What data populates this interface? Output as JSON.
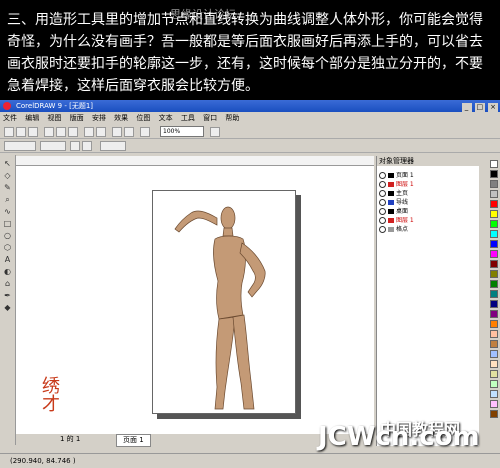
{
  "caption": {
    "watermark": "思缘设计论坛",
    "lines": [
      "三、用造形工具里的增加节点和直线转换为曲线调整人体外形，你可能会觉得",
      "奇怪，为什么没有画手？吾一般都是等后面衣服画好后再添上手的，可以省去",
      "画衣服时还要扣手的轮廓这一步，还有，这时候每个部分是独立分开的，不要",
      "急着焊接，这样后面穿衣服会比较方便。"
    ]
  },
  "app": {
    "title": "CorelDRAW 9 - [无题1]",
    "window_buttons": [
      "_",
      "□",
      "×"
    ],
    "menu": [
      "文件",
      "编辑",
      "视图",
      "版面",
      "安排",
      "效果",
      "位图",
      "文本",
      "工具",
      "窗口",
      "帮助"
    ],
    "zoom": "100%",
    "page_number": "1 的 1",
    "page_tab": "页面 1",
    "status_coords": "(290.940, 84.746 )"
  },
  "layers": {
    "title": "对象管理器",
    "rows": [
      {
        "name": "页面 1",
        "color": "#000000",
        "red": false
      },
      {
        "name": "图层 1",
        "color": "#d02020",
        "red": true
      },
      {
        "name": "主页",
        "color": "#000000",
        "red": false
      },
      {
        "name": "导线",
        "color": "#2040c0",
        "red": false
      },
      {
        "name": "桌面",
        "color": "#000000",
        "red": false
      },
      {
        "name": "图层 1",
        "color": "#d02020",
        "red": true
      },
      {
        "name": "格点",
        "color": "#999999",
        "red": false
      }
    ]
  },
  "figure": {
    "skin_color": "#c49a76"
  },
  "palette": [
    "#ffffff",
    "#000000",
    "#808080",
    "#c0c0c0",
    "#ff0000",
    "#ffff00",
    "#00ff00",
    "#00ffff",
    "#0000ff",
    "#ff00ff",
    "#800000",
    "#808000",
    "#008000",
    "#008080",
    "#000080",
    "#800080",
    "#ff8000",
    "#ffc0a0",
    "#c08040",
    "#a0c0ff",
    "#ffe0c0",
    "#e0e0a0",
    "#c0ffc0",
    "#c0e0ff",
    "#ffc0ff",
    "#804000"
  ],
  "seal": "绣才",
  "watermark_bottom": {
    "main": "JCWcn.com",
    "cn": "中国教程网"
  }
}
